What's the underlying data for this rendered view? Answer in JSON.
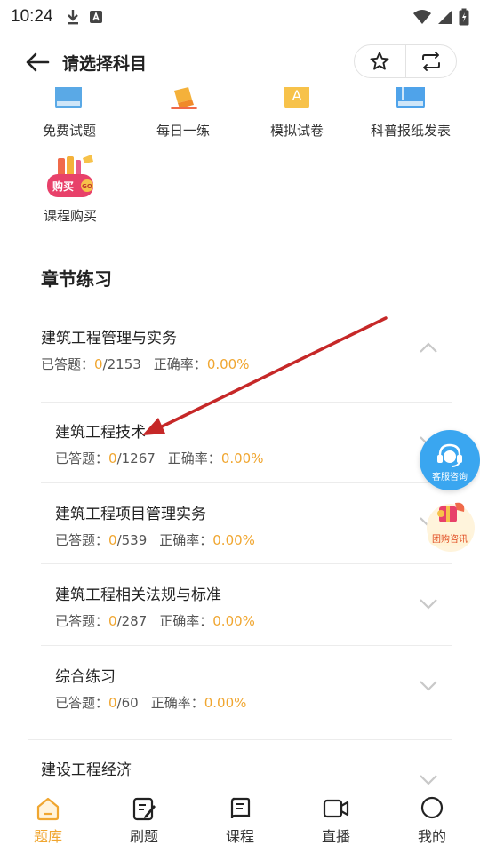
{
  "status_bar": {
    "time": "10:24"
  },
  "header": {
    "title": "请选择科目"
  },
  "quick_actions": [
    {
      "label": "免费试题",
      "icon": "book-icon"
    },
    {
      "label": "每日一练",
      "icon": "pencil-icon"
    },
    {
      "label": "模拟试卷",
      "icon": "exam-paper-icon"
    },
    {
      "label": "科普报纸发表",
      "icon": "newspaper-icon"
    }
  ],
  "course_purchase": {
    "label": "课程购买",
    "badge": "购买",
    "badge_go": "GO"
  },
  "section": {
    "title": "章节练习"
  },
  "chapters": [
    {
      "title": "建筑工程管理与实务",
      "answered_label": "已答题：",
      "answered": "0",
      "total": "/2153",
      "accuracy_label": "正确率：",
      "accuracy": "0.00%",
      "expanded": true
    },
    {
      "title": "建筑工程技术",
      "answered_label": "已答题：",
      "answered": "0",
      "total": "/1267",
      "accuracy_label": "正确率：",
      "accuracy": "0.00%"
    },
    {
      "title": "建筑工程项目管理实务",
      "answered_label": "已答题：",
      "answered": "0",
      "total": "/539",
      "accuracy_label": "正确率：",
      "accuracy": "0.00%"
    },
    {
      "title": "建筑工程相关法规与标准",
      "answered_label": "已答题：",
      "answered": "0",
      "total": "/287",
      "accuracy_label": "正确率：",
      "accuracy": "0.00%"
    },
    {
      "title": "综合练习",
      "answered_label": "已答题：",
      "answered": "0",
      "total": "/60",
      "accuracy_label": "正确率：",
      "accuracy": "0.00%"
    },
    {
      "title": "建设工程经济"
    }
  ],
  "floating": {
    "service_label": "客服咨询",
    "group_label": "团购咨讯"
  },
  "bottom_nav": [
    {
      "label": "题库",
      "icon": "home-icon",
      "active": true
    },
    {
      "label": "刷题",
      "icon": "edit-icon"
    },
    {
      "label": "课程",
      "icon": "course-book-icon"
    },
    {
      "label": "直播",
      "icon": "video-icon"
    },
    {
      "label": "我的",
      "icon": "profile-icon"
    }
  ],
  "colors": {
    "accent": "#f0a630",
    "annotation_arrow": "#c62828",
    "service_button": "#3aa6f0"
  }
}
